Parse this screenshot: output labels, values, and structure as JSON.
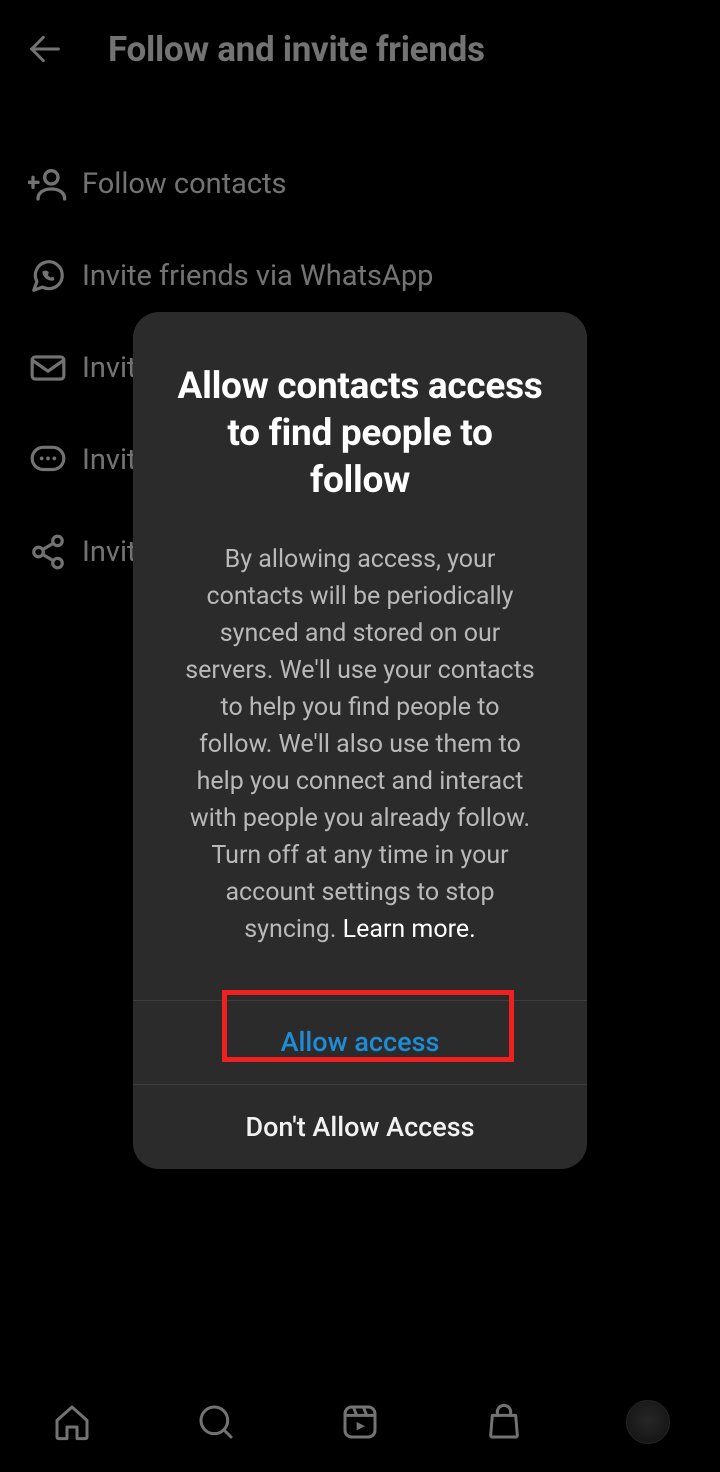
{
  "header": {
    "title": "Follow and invite friends"
  },
  "menu": {
    "items": [
      {
        "label": "Follow contacts",
        "icon": "person-plus-icon"
      },
      {
        "label": "Invite friends via WhatsApp",
        "icon": "whatsapp-icon"
      },
      {
        "label": "Invite friends via email",
        "icon": "mail-icon"
      },
      {
        "label": "Invite friends via SMS",
        "icon": "sms-icon"
      },
      {
        "label": "Invite friends via…",
        "icon": "share-icon"
      }
    ]
  },
  "modal": {
    "title": "Allow contacts access to find people to follow",
    "body": "By allowing access, your contacts will be periodically synced and stored on our servers. We'll use your contacts to help you find people to follow. We'll also use them to help you connect and interact with people you already follow. Turn off at any time in your account settings to stop syncing. ",
    "learn_more": "Learn more.",
    "allow_label": "Allow access",
    "deny_label": "Don't Allow Access"
  },
  "nav": {
    "items": [
      "home",
      "search",
      "reels",
      "shop",
      "profile"
    ]
  }
}
